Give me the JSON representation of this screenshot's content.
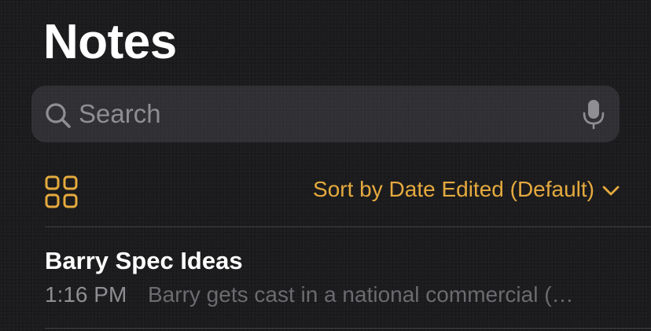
{
  "header": {
    "title": "Notes"
  },
  "search": {
    "placeholder": "Search",
    "search_icon": "magnifying-glass",
    "mic_icon": "microphone"
  },
  "toolbar": {
    "view_icon": "gallery-grid",
    "sort_label": "Sort by Date Edited (Default)",
    "sort_icon": "chevron-down"
  },
  "notes": [
    {
      "title": "Barry Spec Ideas",
      "time": "1:16 PM",
      "preview": "Barry gets cast in a national commercial (…"
    }
  ],
  "colors": {
    "accent": "#e5aa3e",
    "background": "#1c1c1e",
    "secondary_text": "#8e8e93"
  }
}
